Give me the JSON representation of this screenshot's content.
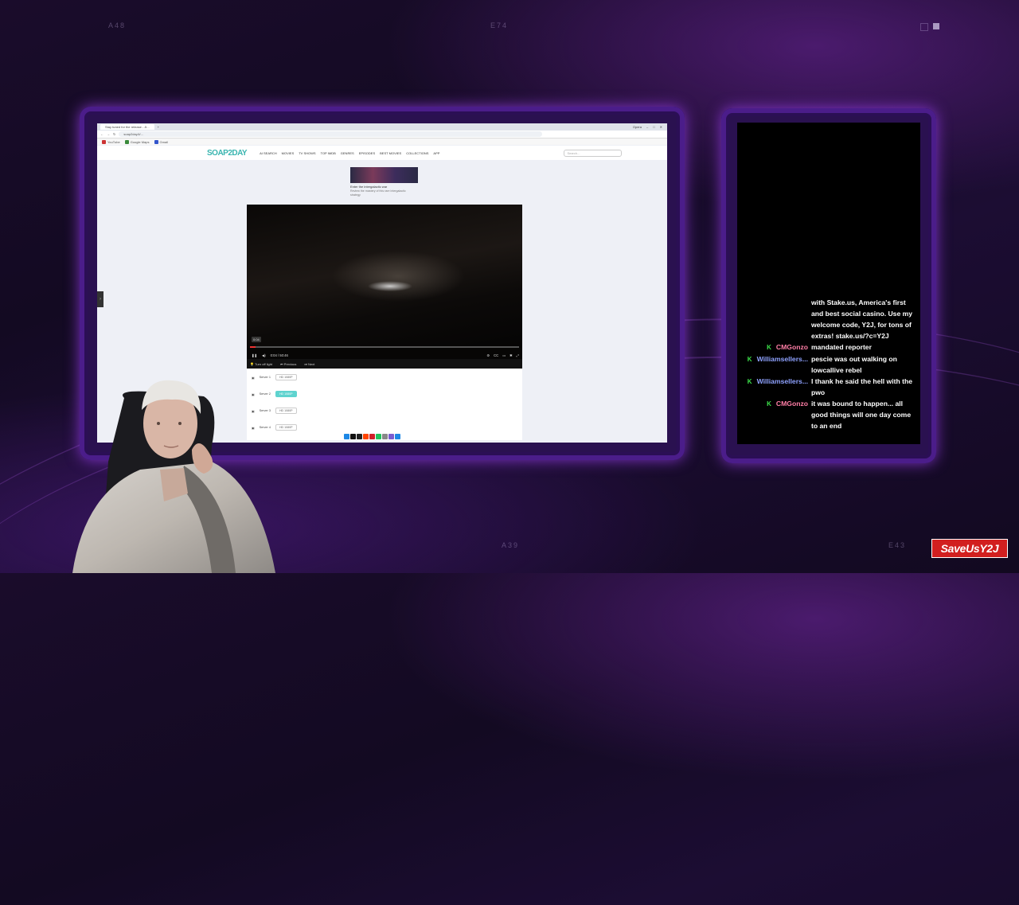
{
  "overlay": {
    "corner_labels": {
      "top_left": "A48",
      "top_center": "E74",
      "bottom_center": "A39",
      "bottom_right": "E43"
    },
    "watermark": "SaveUsY2J",
    "colors": {
      "accent_purple": "#4b1d8a",
      "chat_cm": "#ff7ea6",
      "chat_ws": "#8fa2ff",
      "badge_green": "#3ce04a",
      "watermark_red": "#d21f1f"
    }
  },
  "browser": {
    "tab_label": "Stay tuned for the release - Ji...",
    "window_label": "Opera",
    "address": "soap2day.lt/...",
    "bookmarks": [
      "YouTube",
      "Google Maps",
      "Gmail"
    ],
    "site": {
      "logo": "SOAP2DAY",
      "nav": [
        "AI SEARCH",
        "MOVIES",
        "TV SHOWS",
        "TOP IMDB",
        "GENRES",
        "EPISODES",
        "BEST MOVIES",
        "COLLECTIONS",
        "APP"
      ],
      "search_placeholder": "Search..."
    },
    "promo": {
      "title": "Enter the intergalactic war",
      "desc": "Review the mastery of this rare intergalactic strategy"
    },
    "player": {
      "time_tip": "0:04",
      "time_display": "0:04 / 50:46",
      "progress": 0.02,
      "bar_items": [
        "Turn off light",
        "Previous",
        "Next"
      ]
    },
    "servers": [
      {
        "label": "Server 1",
        "button": "HD 1080P",
        "active": false
      },
      {
        "label": "Server 2",
        "button": "HD 1080P",
        "active": true
      },
      {
        "label": "Server 3",
        "button": "HD 1080P",
        "active": false
      },
      {
        "label": "Server 4",
        "button": "HD 1080P",
        "active": false
      }
    ]
  },
  "chat": {
    "messages": [
      {
        "user": "",
        "badge": false,
        "user_color": "",
        "text": "with Stake.us, America's first and best social casino. Use my welcome code, Y2J, for tons of extras! stake.us/?c=Y2J"
      },
      {
        "user": "CMGonzo",
        "badge": true,
        "user_color": "#ff7ea6",
        "text": "mandated reporter"
      },
      {
        "user": "Williamsellers...",
        "badge": true,
        "user_color": "#8fa2ff",
        "text": "pescie was out walking on lowcallive rebel"
      },
      {
        "user": "Williamsellers...",
        "badge": true,
        "user_color": "#8fa2ff",
        "text": "I thank he said the hell with the pwo"
      },
      {
        "user": "CMGonzo",
        "badge": true,
        "user_color": "#ff7ea6",
        "text": "it was bound to happen... all good things will one day come to an end"
      }
    ]
  }
}
